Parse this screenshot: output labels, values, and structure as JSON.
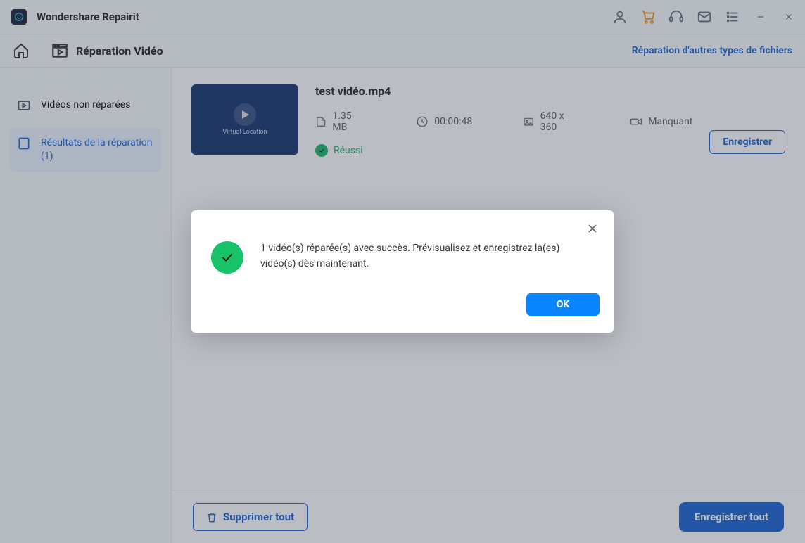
{
  "app": {
    "title": "Wondershare Repairit"
  },
  "header": {
    "crumb": "Réparation Vidéo",
    "other_link": "Réparation d'autres types de fichiers"
  },
  "sidebar": {
    "items": [
      {
        "label": "Vidéos non réparées",
        "active": false
      },
      {
        "label": "Résultats de la réparation (1)",
        "active": true
      }
    ]
  },
  "file": {
    "name": "test vidéo.mp4",
    "thumb_caption": "Virtual Location",
    "size": "1.35  MB",
    "duration": "00:00:48",
    "dimensions": "640 x 360",
    "source": "Manquant",
    "status": "Réussi",
    "save_label": "Enregistrer"
  },
  "footer": {
    "delete_all": "Supprimer tout",
    "save_all": "Enregistrer tout"
  },
  "modal": {
    "message": "1 vidéo(s) réparée(s) avec succès. Prévisualisez et enregistrez la(es) vidéo(s) dès maintenant.",
    "ok": "OK"
  }
}
